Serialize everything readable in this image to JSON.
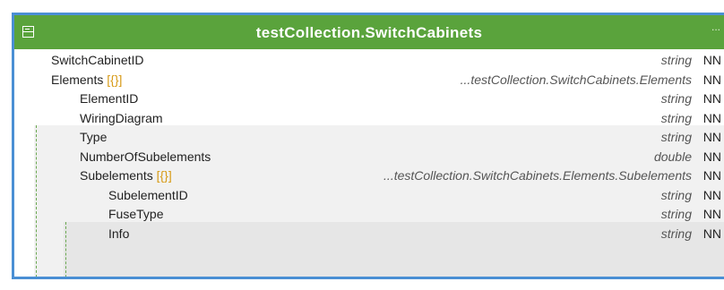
{
  "collection": {
    "title": "testCollection.SwitchCabinets",
    "icon": "table-icon",
    "menu_glyph": "..."
  },
  "fields": [
    {
      "name": "SwitchCabinetID",
      "brackets": "",
      "type": "string",
      "constraint": "NN",
      "level": 0
    },
    {
      "name": "Elements",
      "brackets": "[{}]",
      "type": "...testCollection.SwitchCabinets.Elements",
      "constraint": "NN",
      "level": 0
    },
    {
      "name": "ElementID",
      "brackets": "",
      "type": "string",
      "constraint": "NN",
      "level": 1
    },
    {
      "name": "WiringDiagram",
      "brackets": "",
      "type": "string",
      "constraint": "NN",
      "level": 1
    },
    {
      "name": "Type",
      "brackets": "",
      "type": "string",
      "constraint": "NN",
      "level": 1
    },
    {
      "name": "NumberOfSubelements",
      "brackets": "",
      "type": "double",
      "constraint": "NN",
      "level": 1
    },
    {
      "name": "Subelements",
      "brackets": "[{}]",
      "type": "...testCollection.SwitchCabinets.Elements.Subelements",
      "constraint": "NN",
      "level": 1
    },
    {
      "name": "SubelementID",
      "brackets": "",
      "type": "string",
      "constraint": "NN",
      "level": 2
    },
    {
      "name": "FuseType",
      "brackets": "",
      "type": "string",
      "constraint": "NN",
      "level": 2
    },
    {
      "name": "Info",
      "brackets": "",
      "type": "string",
      "constraint": "NN",
      "level": 2
    }
  ]
}
